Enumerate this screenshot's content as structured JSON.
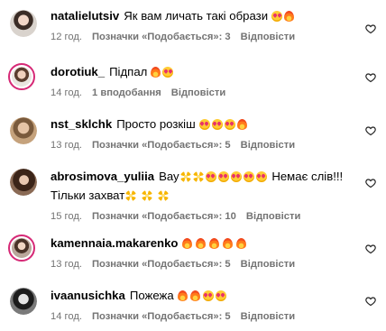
{
  "comments": [
    {
      "username": "natalielutsiv",
      "text": "Як вам личать такі образи",
      "emojis": [
        "heart-eyes",
        "fire"
      ],
      "time": "12 год.",
      "likes": "Позначки «Подобається»: 3",
      "reply": "Відповісти"
    },
    {
      "username": "dorotiuk_",
      "text": "Підпал",
      "emojis": [
        "fire",
        "heart-eyes"
      ],
      "time": "14 год.",
      "likes": "1 вподобання",
      "reply": "Відповісти"
    },
    {
      "username": "nst_sklchk",
      "text": "Просто розкіш",
      "emojis": [
        "heart-eyes",
        "heart-eyes",
        "heart-eyes",
        "fire"
      ],
      "time": "13 год.",
      "likes": "Позначки «Подобається»: 5",
      "reply": "Відповісти"
    },
    {
      "username": "abrosimova_yuliia",
      "text": "Вау",
      "emojis": [
        "sparkles",
        "sparkles",
        "heart-eyes",
        "heart-eyes",
        "heart-eyes",
        "heart-eyes",
        "heart-eyes"
      ],
      "text_after": "Немає слів!!!",
      "text_line2": "Тільки захват",
      "emojis_line2": [
        "sparkles",
        "sparkles",
        "sparkles"
      ],
      "time": "15 год.",
      "likes": "Позначки «Подобається»: 10",
      "reply": "Відповісти"
    },
    {
      "username": "kamennaia.makarenko",
      "text": "",
      "emojis": [
        "fire",
        "fire",
        "fire",
        "fire",
        "fire"
      ],
      "time": "13 год.",
      "likes": "Позначки «Подобається»: 5",
      "reply": "Відповісти"
    },
    {
      "username": "ivaanusichka",
      "text": "Пожежа",
      "emojis": [
        "fire",
        "fire",
        "heart-eyes",
        "heart-eyes"
      ],
      "time": "14 год.",
      "likes": "Позначки «Подобається»: 5",
      "reply": "Відповісти"
    }
  ],
  "icons": {
    "like": "heart-outline-icon"
  },
  "colors": {
    "meta_text": "#737373",
    "ring": "#d62976"
  }
}
